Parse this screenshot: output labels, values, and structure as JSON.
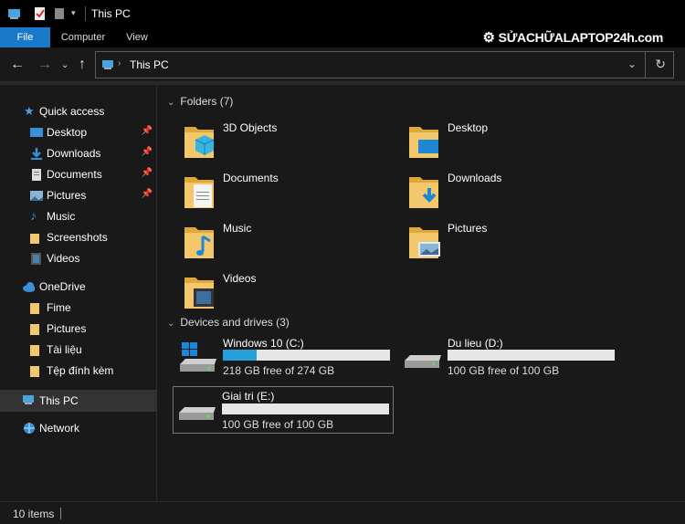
{
  "window": {
    "title": "This PC"
  },
  "ribbon": {
    "tabs": [
      "File",
      "Computer",
      "View"
    ],
    "brand": "SỬACHỮALAPTOP24h.com"
  },
  "address": {
    "path": "This PC"
  },
  "sidebar": {
    "quick_access": "Quick access",
    "quick_items": [
      {
        "label": "Desktop",
        "icon": "desktop-icon",
        "pinned": true
      },
      {
        "label": "Downloads",
        "icon": "downloads-icon",
        "pinned": true
      },
      {
        "label": "Documents",
        "icon": "documents-icon",
        "pinned": true
      },
      {
        "label": "Pictures",
        "icon": "pictures-icon",
        "pinned": true
      },
      {
        "label": "Music",
        "icon": "music-icon",
        "pinned": false
      },
      {
        "label": "Screenshots",
        "icon": "folder-icon",
        "pinned": false
      },
      {
        "label": "Videos",
        "icon": "videos-icon",
        "pinned": false
      }
    ],
    "onedrive": "OneDrive",
    "onedrive_items": [
      "Fime",
      "Pictures",
      "Tài liệu",
      "Tệp đính kèm"
    ],
    "this_pc": "This PC",
    "network": "Network"
  },
  "folders": {
    "header": "Folders (7)",
    "items": [
      "3D Objects",
      "Desktop",
      "Documents",
      "Downloads",
      "Music",
      "Pictures",
      "Videos"
    ]
  },
  "drives": {
    "header": "Devices and drives (3)",
    "items": [
      {
        "name": "Windows 10 (C:)",
        "free": "218 GB free of 274 GB",
        "used_fraction": 0.2
      },
      {
        "name": "Du lieu (D:)",
        "free": "100 GB free of 100 GB",
        "used_fraction": 0
      },
      {
        "name": "Giai tri (E:)",
        "free": "100 GB free of 100 GB",
        "used_fraction": 0
      }
    ]
  },
  "status": {
    "count": "10 items"
  },
  "colors": {
    "accent": "#1979ca",
    "drive_fill": "#26a0da",
    "folder": "#f3c76b"
  }
}
